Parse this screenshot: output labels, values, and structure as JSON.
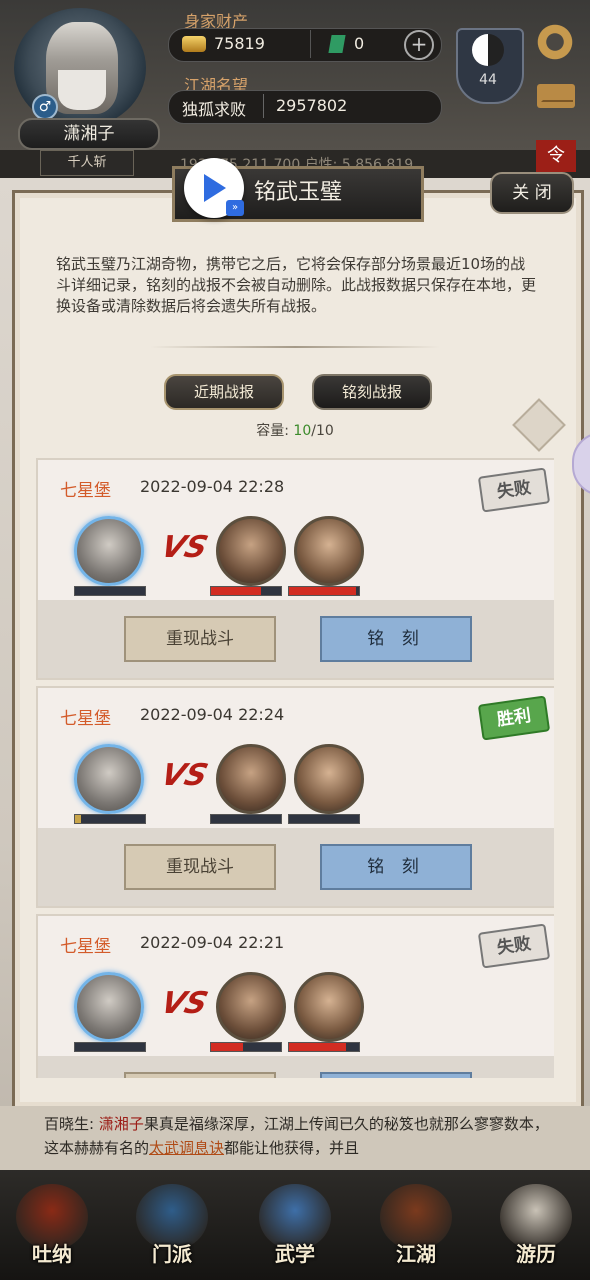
{
  "hud": {
    "wealth_label": "身家财产",
    "gold_value": "75819",
    "jade_value": "0",
    "plus_symbol": "+",
    "reputation_label": "江湖名望",
    "rank_title": "独孤求败",
    "reputation_value": "2957802",
    "player_name": "潇湘子",
    "player_title": "千人斩",
    "gender_symbol": "♂",
    "level": "44",
    "behind_text": "193 275 211 700   户性: 5,856,819",
    "red_badge": "令"
  },
  "panel": {
    "title": "铭武玉璧",
    "close_label": "关 闭",
    "ff_symbol": "»",
    "description": "铭武玉璧乃江湖奇物，携带它之后，它将会保存部分场景最近10场的战斗详细记录，铭刻的战报不会被自动删除。此战报数据只保存在本地，更换设备或清除数据后将会遗失所有战报。",
    "tab_recent": "近期战报",
    "tab_carved": "铭刻战报",
    "capacity_label": "容量: ",
    "capacity_used": "10",
    "capacity_total": "/10",
    "vs_text": "VS",
    "replay_label": "重现战斗",
    "carve_label": "铭 刻",
    "records": [
      {
        "place": "七星堡",
        "time": "2022-09-04 22:28",
        "result": "失败",
        "result_type": "lose",
        "my_hp": 0,
        "enemy_hp": [
          0.72,
          0.95
        ]
      },
      {
        "place": "七星堡",
        "time": "2022-09-04 22:24",
        "result": "胜利",
        "result_type": "win",
        "my_hp": 0.08,
        "enemy_hp": [
          0,
          0
        ]
      },
      {
        "place": "七星堡",
        "time": "2022-09-04 22:21",
        "result": "失败",
        "result_type": "lose",
        "my_hp": 0,
        "enemy_hp": [
          0.45,
          0.82
        ]
      }
    ]
  },
  "story": {
    "prefix": "百晓生: ",
    "name": "潇湘子",
    "text1": "果真是福缘深厚，江湖上传闻已久的秘笈也就那么寥寥数本，这本赫赫有名的",
    "item": "太武调息诀",
    "text2": "都能让他获得，并且"
  },
  "nav": [
    {
      "label": "吐纳",
      "icon": "meditation-icon",
      "color": "#8a2a16"
    },
    {
      "label": "门派",
      "icon": "sect-flag-icon",
      "color": "#2f5d8a"
    },
    {
      "label": "武学",
      "icon": "scroll-book-icon",
      "color": "#3e6fa8"
    },
    {
      "label": "江湖",
      "icon": "bamboo-hat-icon",
      "color": "#7b3a1e"
    },
    {
      "label": "游历",
      "icon": "horse-icon",
      "color": "#c9c2b6"
    }
  ]
}
